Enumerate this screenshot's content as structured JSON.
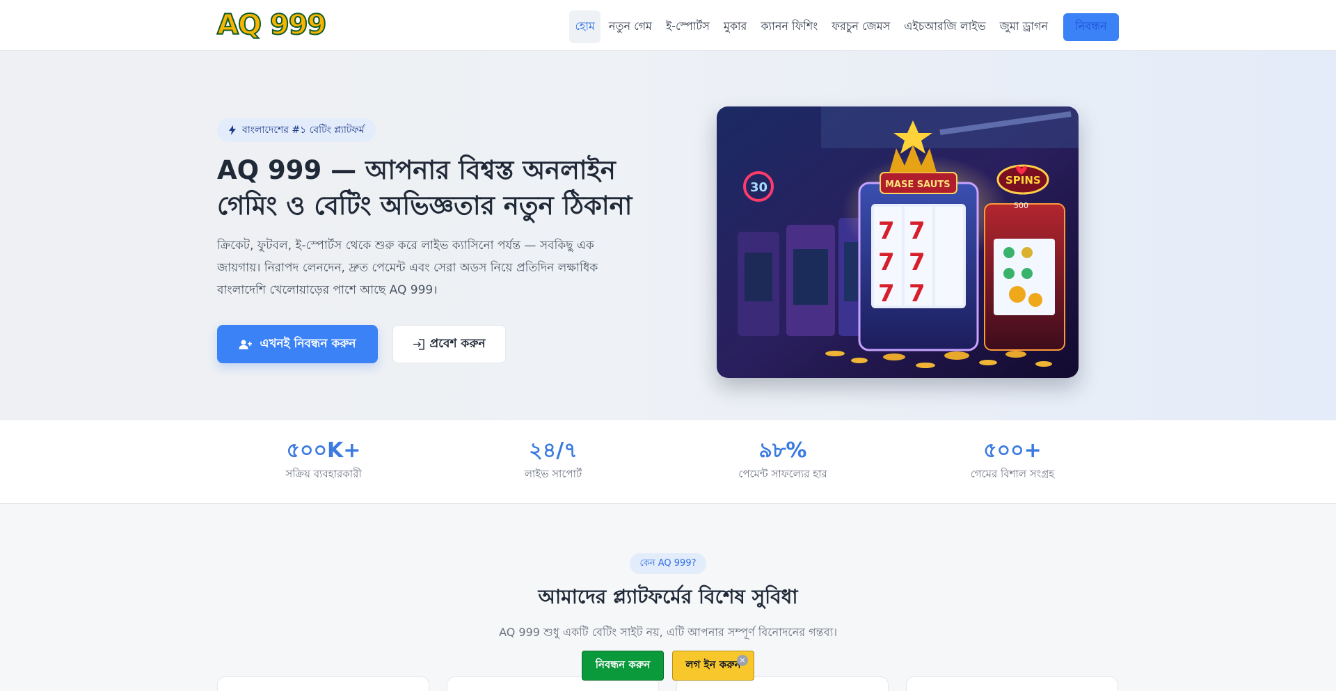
{
  "header": {
    "logo": "AQ 999",
    "nav": [
      "হোম",
      "নতুন গেম",
      "ই-স্পোর্টস",
      "মুকার",
      "ক্যানন ফিশিং",
      "ফরচুন জেমস",
      "এইচআরজি লাইভ",
      "জুমা ড্রাগন"
    ],
    "active_index": 0,
    "cta": "নিবন্ধন"
  },
  "hero": {
    "badge": "বাংলাদেশের #১ বেটিং প্ল্যাটফর্ম",
    "title": "AQ 999 — আপনার বিশ্বস্ত অনলাইন গেমিং ও বেটিং অভিজ্ঞতার নতুন ঠিকানা",
    "description": "ক্রিকেট, ফুটবল, ই-স্পোর্টস থেকে শুরু করে লাইভ ক্যাসিনো পর্যন্ত — সবকিছু এক জায়গায়। নিরাপদ লেনদেন, দ্রুত পেমেন্ট এবং সেরা অডস নিয়ে প্রতিদিন লক্ষাধিক বাংলাদেশি খেলোয়াড়ের পাশে আছে AQ 999।",
    "primary_button": "এখনই নিবন্ধন করুন",
    "secondary_button": "প্রবেশ করুন",
    "image_text": {
      "sign_left": "MASE SAUTS",
      "sign_right": "SPINS",
      "number": "500",
      "neon": "30"
    }
  },
  "stats": [
    {
      "value": "৫০০K+",
      "label": "সক্রিয় ব্যবহারকারী"
    },
    {
      "value": "২৪/৭",
      "label": "লাইভ সাপোর্ট"
    },
    {
      "value": "৯৮%",
      "label": "পেমেন্ট সাফল্যের হার"
    },
    {
      "value": "৫০০+",
      "label": "গেমের বিশাল সংগ্রহ"
    }
  ],
  "features": {
    "badge": "কেন AQ 999?",
    "title": "আমাদের প্ল্যাটফর্মের বিশেষ সুবিধা",
    "subtitle": "AQ 999 শুধু একটি বেটিং সাইট নয়, এটি আপনার সম্পূর্ণ বিনোদনের গন্তব্য।"
  },
  "floating": {
    "register": "নিবন্ধন করুন",
    "login": "লগ ইন করুন",
    "close": "×"
  },
  "colors": {
    "primary": "#3b82f6",
    "stat_value": "#3b7ae0",
    "float_register": "#0a9a3c",
    "float_login": "#f8c72b"
  }
}
